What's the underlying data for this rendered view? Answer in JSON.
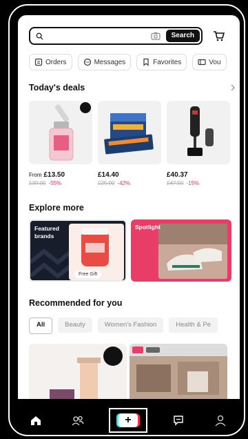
{
  "search": {
    "placeholder": "",
    "button_label": "Search"
  },
  "quick_tabs": [
    {
      "label": "Orders",
      "icon": "orders-icon"
    },
    {
      "label": "Messages",
      "icon": "messages-icon"
    },
    {
      "label": "Favorites",
      "icon": "bookmark-icon"
    },
    {
      "label": "Vou",
      "icon": "voucher-icon"
    }
  ],
  "deals": {
    "title": "Today's deals",
    "items": [
      {
        "price_prefix": "From",
        "price": "£13.50",
        "original": "£30.00",
        "discount": "-55%"
      },
      {
        "price_prefix": "",
        "price": "£14.40",
        "original": "£25.00",
        "discount": "-42%"
      },
      {
        "price_prefix": "",
        "price": "£40.37",
        "original": "£47.50",
        "discount": "-15%"
      }
    ]
  },
  "explore": {
    "title": "Explore more",
    "featured_label": "Featured brands",
    "featured_badge": "Free Gift",
    "spotlight_label": "Spotlight"
  },
  "recommended": {
    "title": "Recommended for you",
    "filters": [
      "All",
      "Beauty",
      "Women's Fashion",
      "Health & Pe"
    ]
  },
  "nav": {
    "items": [
      "home-icon",
      "friends-icon",
      "create-icon",
      "inbox-icon",
      "profile-icon"
    ],
    "create_glyph": "+"
  },
  "colors": {
    "accent_pink": "#ef3a6a",
    "spotlight_bg": "#e83d67",
    "featured_bg": "#171d2b"
  }
}
